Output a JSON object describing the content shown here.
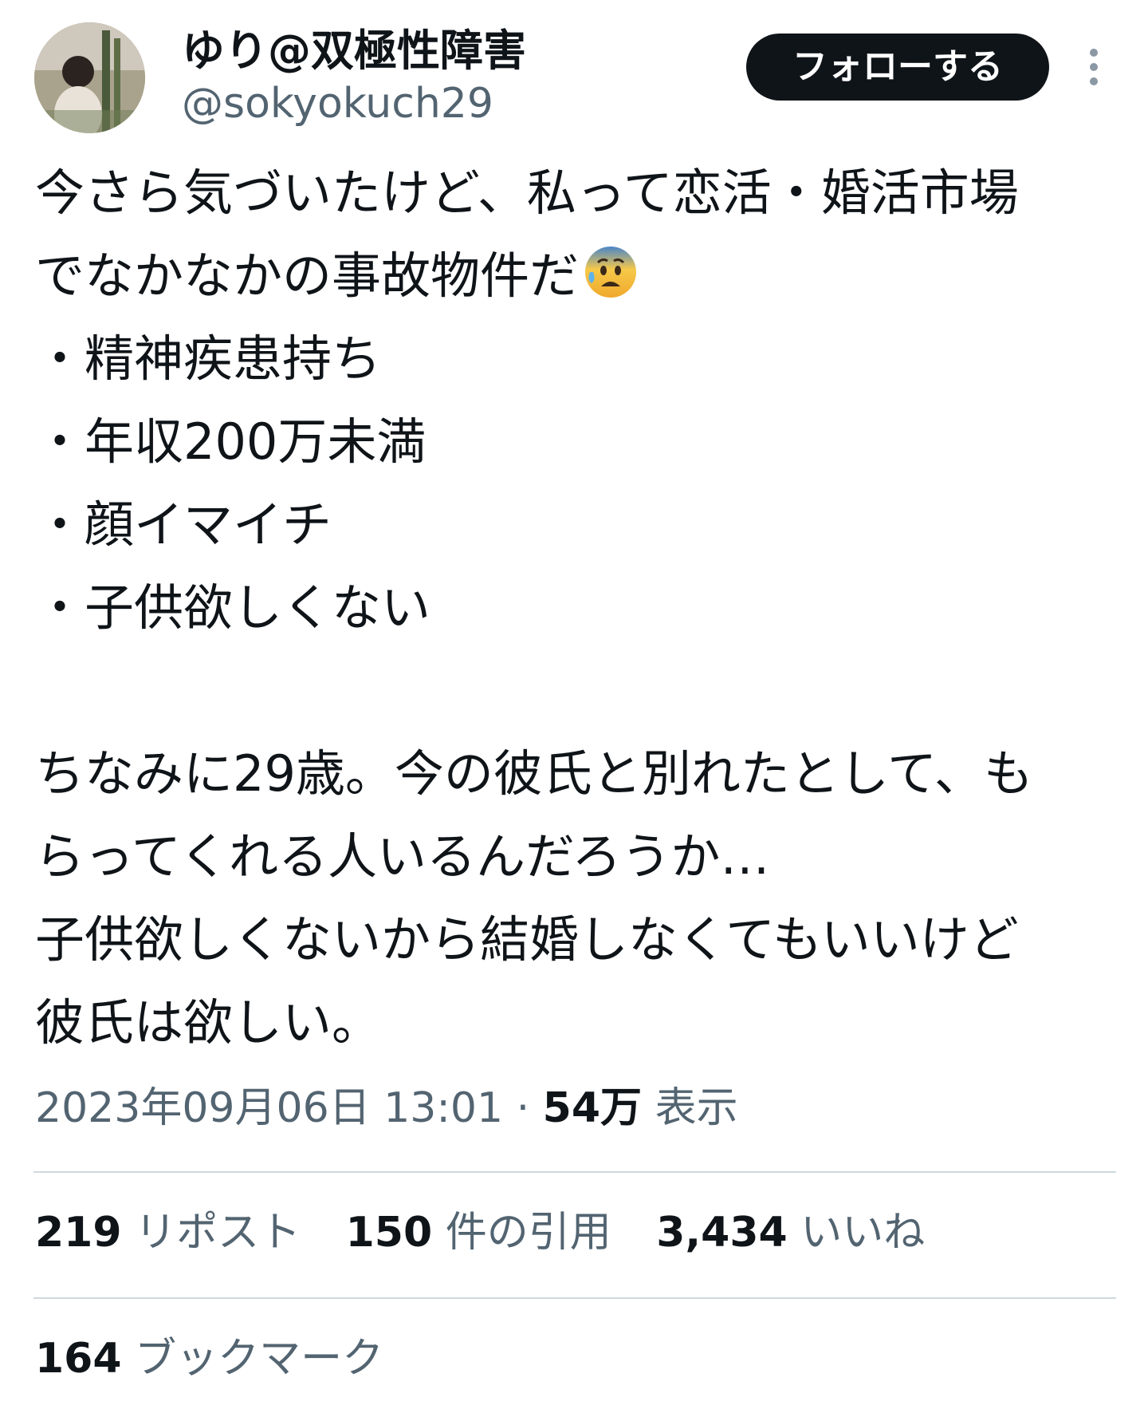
{
  "user": {
    "display_name": "ゆり@双極性障害",
    "handle": "@sokyokuch29"
  },
  "follow_button": {
    "label": "フォローする"
  },
  "tweet": {
    "lines": [
      "今さら気づいたけど、私って恋活・婚活市場",
      "でなかなかの事故物件だ",
      "・精神疾患持ち",
      "・年収200万未満",
      "・顔イマイチ",
      "・子供欲しくない",
      "",
      "ちなみに29歳。今の彼氏と別れたとして、も",
      "らってくれる人いるんだろうか…",
      "子供欲しくないから結婚しなくてもいいけど",
      "彼氏は欲しい。"
    ],
    "emoji": "anxious-face-with-sweat-icon"
  },
  "meta": {
    "timestamp": "2023年09月06日 13:01",
    "separator": "·",
    "views_count": "54万",
    "views_label": "表示"
  },
  "stats": {
    "reposts_count": "219",
    "reposts_label": "リポスト",
    "quotes_count": "150",
    "quotes_label": "件の引用",
    "likes_count": "3,434",
    "likes_label": "いいね",
    "bookmarks_count": "164",
    "bookmarks_label": "ブックマーク"
  },
  "colors": {
    "text_primary": "#0f1419",
    "text_secondary": "#536471",
    "divider": "#cfd9de",
    "button_bg": "#0f1419",
    "button_text": "#ffffff"
  }
}
